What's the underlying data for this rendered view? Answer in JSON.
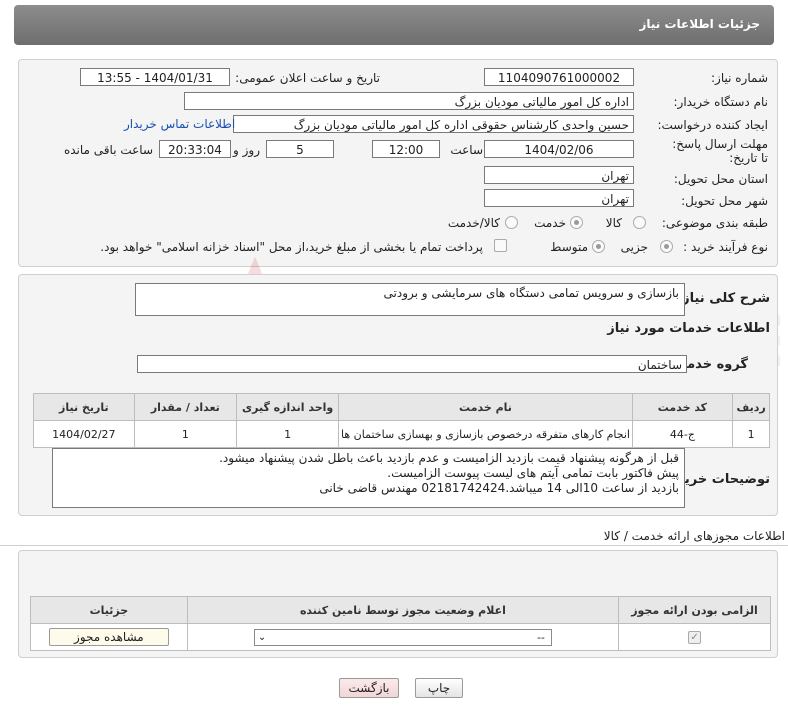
{
  "header": {
    "title": "جزئیات اطلاعات نیاز"
  },
  "form": {
    "need_number_label": "شماره نیاز:",
    "need_number": "1104090761000002",
    "announce_label": "تاریخ و ساعت اعلان عمومی:",
    "announce_value": "1404/01/31 - 13:55",
    "buyer_org_label": "نام دستگاه خریدار:",
    "buyer_org": "اداره کل امور مالیاتی مودیان بزرگ",
    "creator_label": "ایجاد کننده درخواست:",
    "creator": "حسین واحدی کارشناس حقوقی اداره کل امور مالیاتی مودیان بزرگ",
    "contact_link": "اطلاعات تماس خریدار",
    "deadline_label": "مهلت ارسال پاسخ: تا تاریخ:",
    "deadline_date": "1404/02/06",
    "time_label": "ساعت",
    "deadline_time": "12:00",
    "days_value": "5",
    "days_label": "روز و",
    "remaining_time": "20:33:04",
    "remaining_label": "ساعت باقی مانده",
    "province_label": "استان محل تحویل:",
    "province": "تهران",
    "city_label": "شهر محل تحویل:",
    "city": "تهران",
    "category_label": "طبقه بندی موضوعی:",
    "category_options": [
      "کالا",
      "خدمت",
      "کالا/خدمت"
    ],
    "category_selected": "خدمت",
    "process_label": "نوع فرآیند خرید :",
    "process_options": [
      "جزیی",
      "متوسط"
    ],
    "process_selected": "جزیی",
    "payment_note": "پرداخت تمام یا بخشی از مبلغ خرید،از محل \"اسناد خزانه اسلامی\" خواهد بود."
  },
  "details": {
    "summary_label": "شرح کلی نیاز:",
    "summary": "بازسازی و سرویس تمامی دستگاه های سرمایشی و برودتی",
    "services_title": "اطلاعات خدمات مورد نیاز",
    "service_group_label": "گروه خدمت:",
    "service_group": "ساختمان",
    "table": {
      "headers": [
        "ردیف",
        "کد خدمت",
        "نام خدمت",
        "واحد اندازه گیری",
        "تعداد / مقدار",
        "تاریخ نیاز"
      ],
      "rows": [
        [
          "1",
          "ج-44",
          "انجام کارهای متفرقه درخصوص بازسازی و بهسازی ساختمان ها",
          "1",
          "1",
          "1404/02/27"
        ]
      ]
    },
    "buyer_notes_label": "توضیحات خریدار:",
    "buyer_notes": [
      "قبل از هرگونه پیشنهاد قیمت بازدید الزامیست و عدم بازدید باعث باطل شدن پیشنهاد میشود.",
      "پیش فاکتور بابت تمامی آیتم های لیست پیوست الزامیست.",
      "بازدید از ساعت 10الی 14 میباشد.02181742424 مهندس قاضی خانی"
    ]
  },
  "permits": {
    "title": "اطلاعات مجوزهای ارائه خدمت / کالا",
    "headers": [
      "الزامی بودن ارائه مجوز",
      "اعلام وضعیت مجوز توسط نامین کننده",
      "جزئیات"
    ],
    "select_value": "--",
    "view_button": "مشاهده مجوز"
  },
  "footer": {
    "print_button": "چاپ",
    "back_button": "بازگشت"
  },
  "watermark_text": "AriaTender.net",
  "colors": {
    "header": "#7d7d7d",
    "link": "#1a4fb0",
    "back_button_bg": "#f6dede"
  }
}
